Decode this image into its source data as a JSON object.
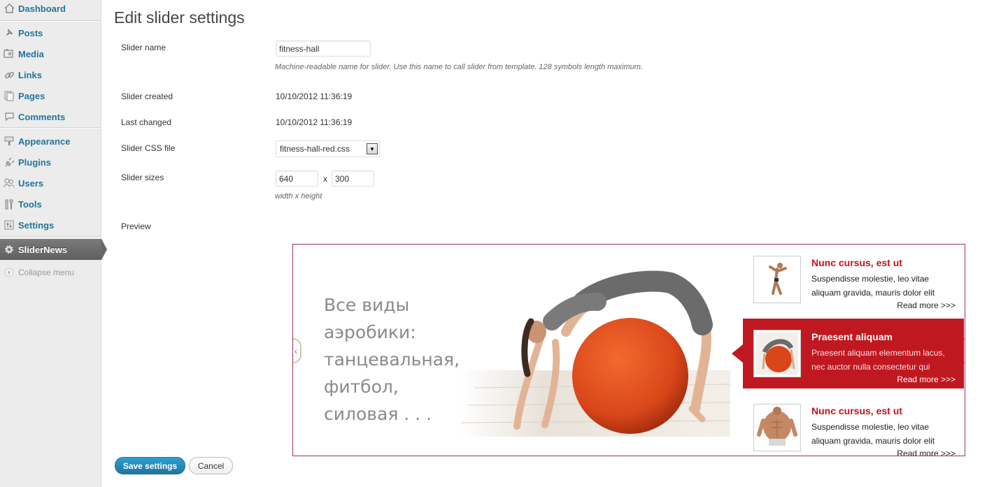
{
  "sidebar": {
    "items": [
      {
        "label": "Dashboard",
        "icon": "dashboard-icon"
      },
      {
        "label": "Posts",
        "icon": "pin-icon"
      },
      {
        "label": "Media",
        "icon": "media-icon"
      },
      {
        "label": "Links",
        "icon": "link-icon"
      },
      {
        "label": "Pages",
        "icon": "pages-icon"
      },
      {
        "label": "Comments",
        "icon": "comment-icon"
      },
      {
        "label": "Appearance",
        "icon": "appearance-icon"
      },
      {
        "label": "Plugins",
        "icon": "plugin-icon"
      },
      {
        "label": "Users",
        "icon": "users-icon"
      },
      {
        "label": "Tools",
        "icon": "tools-icon"
      },
      {
        "label": "Settings",
        "icon": "settings-icon"
      },
      {
        "label": "SliderNews",
        "icon": "gear-icon"
      }
    ],
    "collapse_label": "Collapse menu"
  },
  "page": {
    "title": "Edit slider settings"
  },
  "form": {
    "slider_name_label": "Slider name",
    "slider_name_value": "fitness-hall",
    "slider_name_hint": "Machine-readable name for slider. Use this name to call slider from template. 128 symbols length maximum.",
    "created_label": "Slider created",
    "created_value": "10/10/2012 11:36:19",
    "changed_label": "Last changed",
    "changed_value": "10/10/2012 11:36:19",
    "css_label": "Slider CSS file",
    "css_value": "fitness-hall-red.css",
    "sizes_label": "Slider sizes",
    "width_value": "640",
    "size_separator": "x",
    "height_value": "300",
    "sizes_hint": "width x height",
    "preview_label": "Preview"
  },
  "preview": {
    "slide_text": [
      "Все виды",
      "аэробики:",
      "танцевальная,",
      "фитбол,",
      "силовая . . ."
    ],
    "news": [
      {
        "title": "Nunc cursus, est ut",
        "text": "Suspendisse molestie, leo vitae aliquam gravida, mauris dolor elit",
        "more": "Read more >>>"
      },
      {
        "title": "Praesent aliquam",
        "text": "Praesent aliquam elementum lacus, nec auctor nulla consectetur qui",
        "more": "Read more >>>"
      },
      {
        "title": "Nunc cursus, est ut",
        "text": "Suspendisse molestie, leo vitae aliquam gravida, mauris dolor elit",
        "more": "Read more >>>"
      }
    ],
    "accent_color": "#c01820"
  },
  "actions": {
    "save_label": "Save settings",
    "cancel_label": "Cancel"
  }
}
